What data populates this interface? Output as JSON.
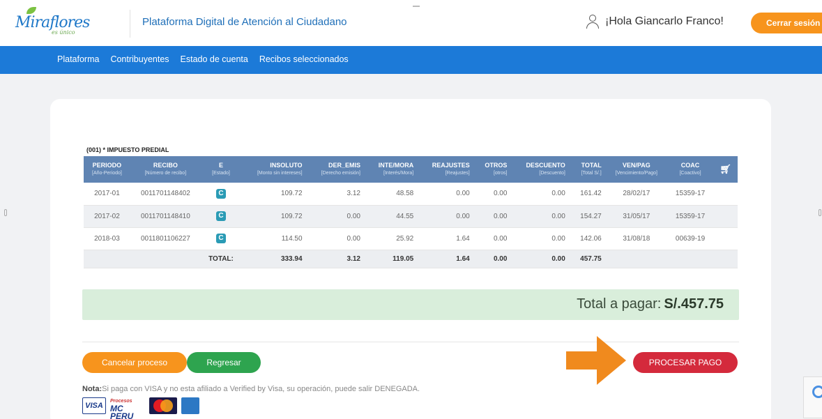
{
  "header": {
    "logo_text": "Miraflores",
    "logo_sub": "es único",
    "app_title": "Plataforma Digital de Atención al Ciudadano",
    "greeting": "¡Hola Giancarlo Franco!",
    "logout_label": "Cerrar sesión"
  },
  "nav": {
    "items": [
      "Plataforma",
      "Contribuyentes",
      "Estado de cuenta",
      "Recibos seleccionados"
    ]
  },
  "section_title": "(001) * IMPUESTO PREDIAL",
  "table": {
    "headers": [
      {
        "label": "PERIODO",
        "sub": "[Año-Periodo]"
      },
      {
        "label": "RECIBO",
        "sub": "[Número de recibo]"
      },
      {
        "label": "E",
        "sub": "[Estado]"
      },
      {
        "label": "INSOLUTO",
        "sub": "[Monto sin intereses]"
      },
      {
        "label": "DER_EMIS",
        "sub": "[Derecho emisión]"
      },
      {
        "label": "INTE/MORA",
        "sub": "[Interés/Mora]"
      },
      {
        "label": "REAJUSTES",
        "sub": "[Reajustes]"
      },
      {
        "label": "OTROS",
        "sub": "[otros]"
      },
      {
        "label": "DESCUENTO",
        "sub": "[Descuento]"
      },
      {
        "label": "TOTAL",
        "sub": "[Total S/.]"
      },
      {
        "label": "VEN/PAG",
        "sub": "[Vencimiento/Pago]"
      },
      {
        "label": "COAC",
        "sub": "[Coactivo]"
      }
    ],
    "rows": [
      {
        "periodo": "2017-01",
        "recibo": "0011701148402",
        "estado": "C",
        "insoluto": "109.72",
        "der_emis": "3.12",
        "inte_mora": "48.58",
        "reajustes": "0.00",
        "otros": "0.00",
        "descuento": "0.00",
        "total": "161.42",
        "ven_pag": "28/02/17",
        "coac": "15359-17"
      },
      {
        "periodo": "2017-02",
        "recibo": "0011701148410",
        "estado": "C",
        "insoluto": "109.72",
        "der_emis": "0.00",
        "inte_mora": "44.55",
        "reajustes": "0.00",
        "otros": "0.00",
        "descuento": "0.00",
        "total": "154.27",
        "ven_pag": "31/05/17",
        "coac": "15359-17"
      },
      {
        "periodo": "2018-03",
        "recibo": "0011801106227",
        "estado": "C",
        "insoluto": "114.50",
        "der_emis": "0.00",
        "inte_mora": "25.92",
        "reajustes": "1.64",
        "otros": "0.00",
        "descuento": "0.00",
        "total": "142.06",
        "ven_pag": "31/08/18",
        "coac": "00639-19"
      }
    ],
    "totals": {
      "label": "TOTAL:",
      "insoluto": "333.94",
      "der_emis": "3.12",
      "inte_mora": "119.05",
      "reajustes": "1.64",
      "otros": "0.00",
      "descuento": "0.00",
      "total": "457.75"
    }
  },
  "total_pagar": {
    "label": "Total a pagar:",
    "amount": "S/.457.75"
  },
  "buttons": {
    "cancel": "Cancelar proceso",
    "back": "Regresar",
    "pay": "PROCESAR PAGO"
  },
  "note": {
    "bold": "Nota:",
    "text": "Si paga con VISA y no esta afiliado a Verified by Visa, su operación, puede salir DENEGADA."
  },
  "payment_methods": {
    "visa": "VISA",
    "mc_peru_top": "Procesos",
    "mc_peru": "MC PERU"
  },
  "colors": {
    "nav": "#1c7ad8",
    "header_accent": "#f7941d",
    "pay_button": "#d42a3c",
    "back_button": "#2ea44f",
    "total_bar": "#d9eedb",
    "table_header": "#5f84b3"
  }
}
